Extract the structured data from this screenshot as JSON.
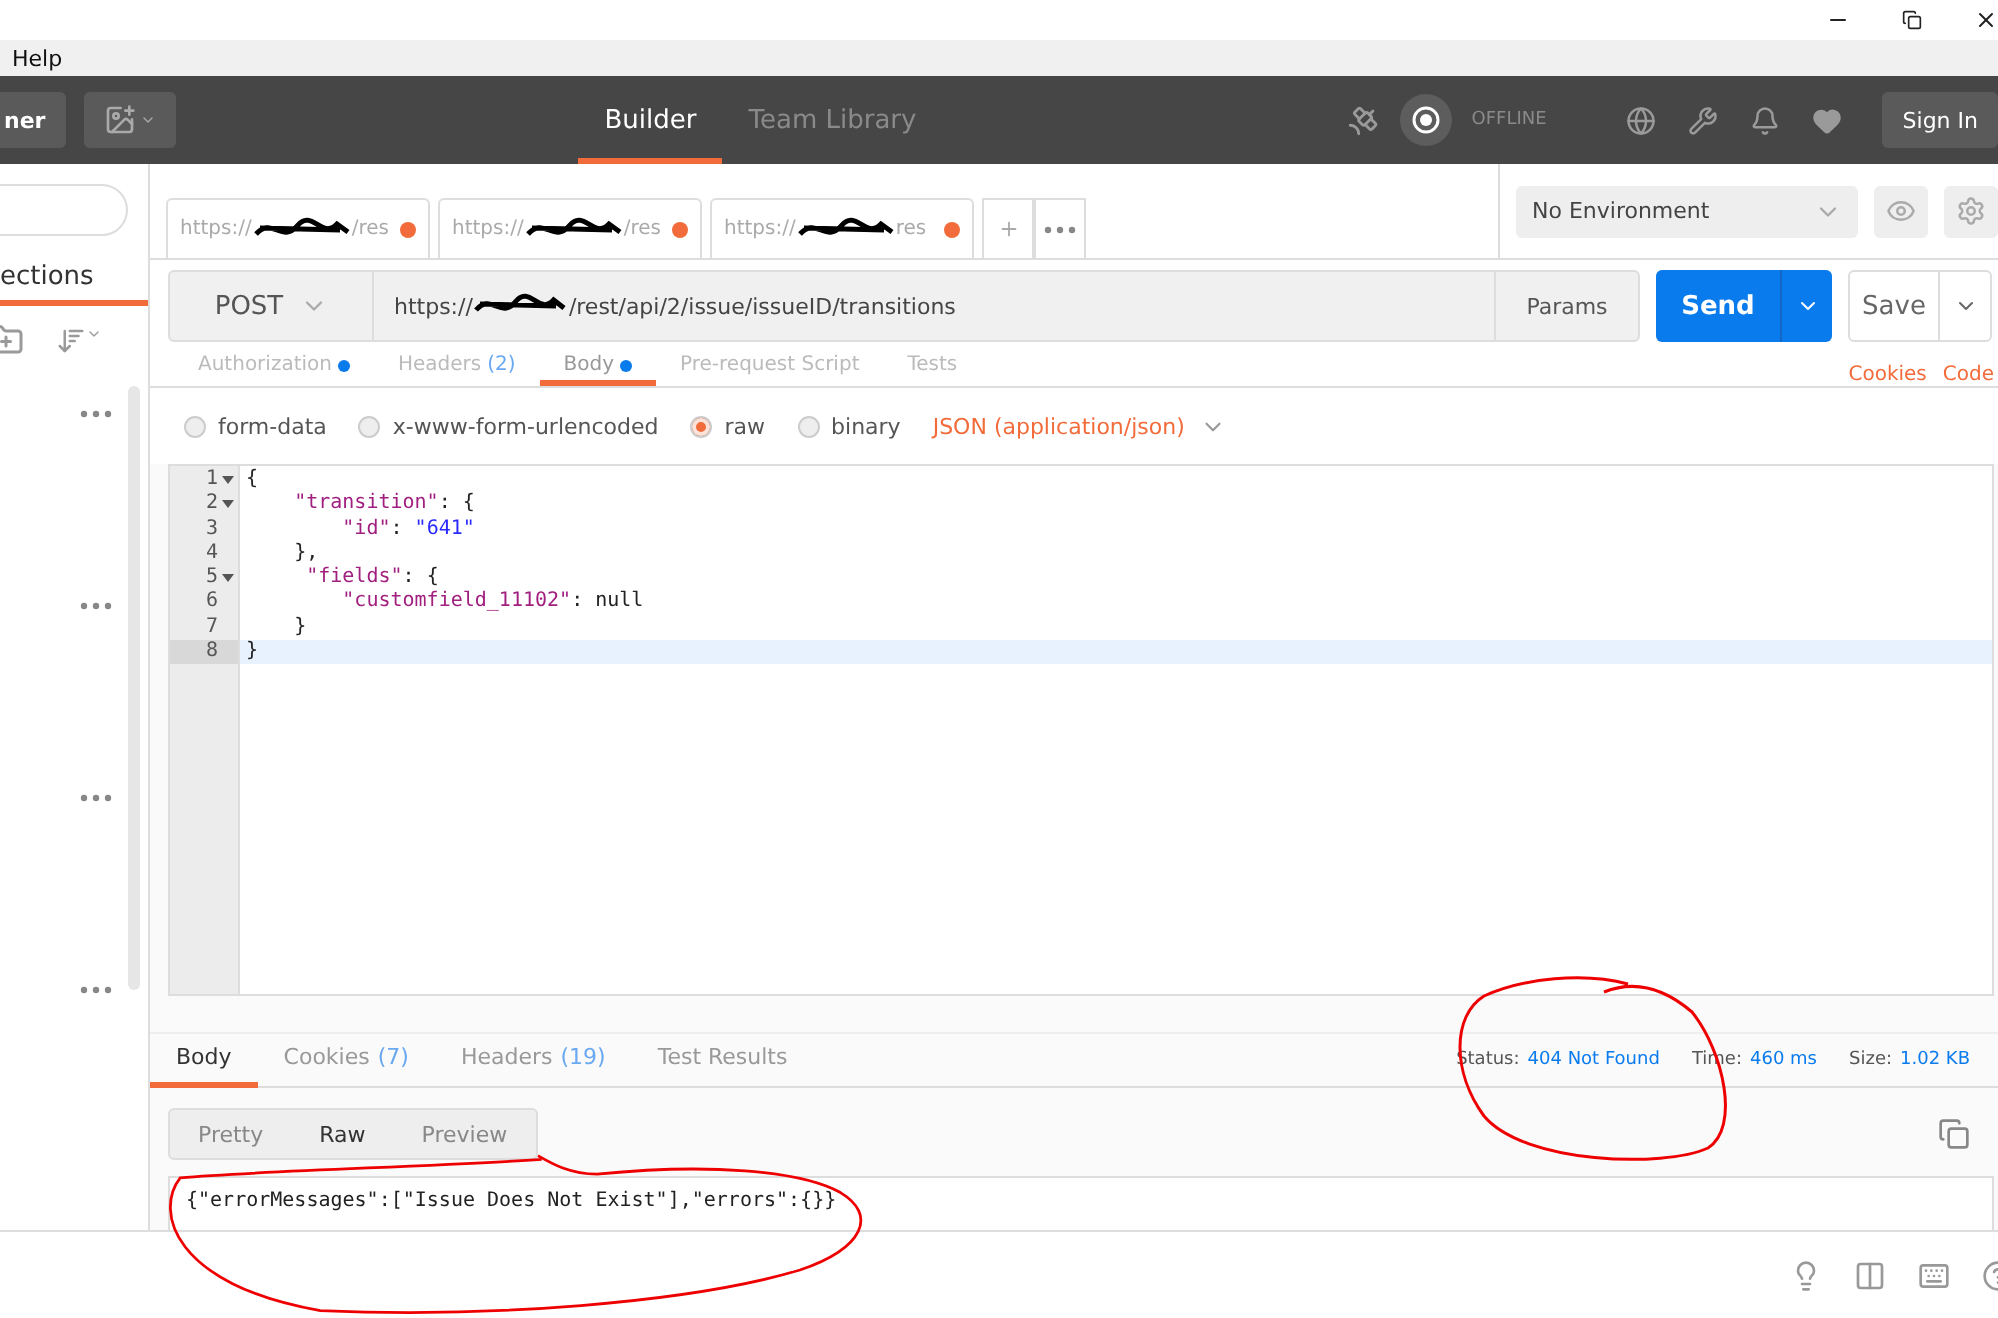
{
  "menu_bar": {
    "items": [
      "Help"
    ]
  },
  "header": {
    "new_button": "ner",
    "nav_tabs": [
      {
        "label": "Builder",
        "selected": true
      },
      {
        "label": "Team Library",
        "selected": false
      }
    ],
    "sync_status": "OFFLINE",
    "sign_in": "Sign In"
  },
  "sidebar": {
    "tab": "ections"
  },
  "request_tabs": [
    {
      "prefix": "https://",
      "suffix": "/res",
      "modified": true
    },
    {
      "prefix": "https://",
      "suffix": "/res",
      "modified": true
    },
    {
      "prefix": "https://",
      "suffix": "res",
      "modified": true
    }
  ],
  "environment": {
    "value": "No Environment"
  },
  "request": {
    "method": "POST",
    "url_prefix": "https://",
    "url_suffix": "/rest/api/2/issue/issueID/transitions",
    "params": "Params",
    "send": "Send",
    "save": "Save"
  },
  "request_sections": [
    {
      "label": "Authorization",
      "dot": true,
      "selected": false
    },
    {
      "label": "Headers",
      "count": "(2)",
      "dot": false,
      "selected": false
    },
    {
      "label": "Body",
      "dot": true,
      "selected": true
    },
    {
      "label": "Pre-request Script",
      "dot": false,
      "selected": false
    },
    {
      "label": "Tests",
      "dot": false,
      "selected": false
    }
  ],
  "request_links": [
    "Cookies",
    "Code"
  ],
  "body_types": [
    {
      "label": "form-data",
      "selected": false
    },
    {
      "label": "x-www-form-urlencoded",
      "selected": false
    },
    {
      "label": "raw",
      "selected": true
    },
    {
      "label": "binary",
      "selected": false
    }
  ],
  "content_type": "JSON (application/json)",
  "editor_lines": [
    {
      "number": "1",
      "foldable": true,
      "active": false,
      "tokens": [
        {
          "kind": "punct",
          "text": "{"
        }
      ]
    },
    {
      "number": "2",
      "foldable": true,
      "active": false,
      "tokens": [
        {
          "kind": "key",
          "text": "    \"transition\""
        },
        {
          "kind": "punct",
          "text": ": {"
        }
      ]
    },
    {
      "number": "3",
      "foldable": false,
      "active": false,
      "tokens": [
        {
          "kind": "key",
          "text": "        \"id\""
        },
        {
          "kind": "punct",
          "text": ": "
        },
        {
          "kind": "string",
          "text": "\"641\""
        }
      ]
    },
    {
      "number": "4",
      "foldable": false,
      "active": false,
      "tokens": [
        {
          "kind": "punct",
          "text": "    },"
        }
      ]
    },
    {
      "number": "5",
      "foldable": true,
      "active": false,
      "tokens": [
        {
          "kind": "key",
          "text": "     \"fields\""
        },
        {
          "kind": "punct",
          "text": ": {"
        }
      ]
    },
    {
      "number": "6",
      "foldable": false,
      "active": false,
      "tokens": [
        {
          "kind": "key",
          "text": "        \"customfield_11102\""
        },
        {
          "kind": "punct",
          "text": ": null"
        }
      ]
    },
    {
      "number": "7",
      "foldable": false,
      "active": false,
      "tokens": [
        {
          "kind": "punct",
          "text": "    }"
        }
      ]
    },
    {
      "number": "8",
      "foldable": false,
      "active": true,
      "tokens": [
        {
          "kind": "punct",
          "text": "}"
        }
      ]
    }
  ],
  "response_tabs": [
    {
      "label": "Body",
      "selected": true
    },
    {
      "label": "Cookies",
      "count": "(7)",
      "selected": false
    },
    {
      "label": "Headers",
      "count": "(19)",
      "selected": false
    },
    {
      "label": "Test Results",
      "selected": false
    }
  ],
  "response_meta": [
    {
      "label": "Status:",
      "value": "404 Not Found"
    },
    {
      "label": "Time:",
      "value": "460 ms"
    },
    {
      "label": "Size:",
      "value": "1.02 KB"
    }
  ],
  "view_modes": [
    {
      "label": "Pretty",
      "selected": false
    },
    {
      "label": "Raw",
      "selected": true
    },
    {
      "label": "Preview",
      "selected": false
    }
  ],
  "response_body": "{\"errorMessages\":[\"Issue Does Not Exist\"],\"errors\":{}}"
}
